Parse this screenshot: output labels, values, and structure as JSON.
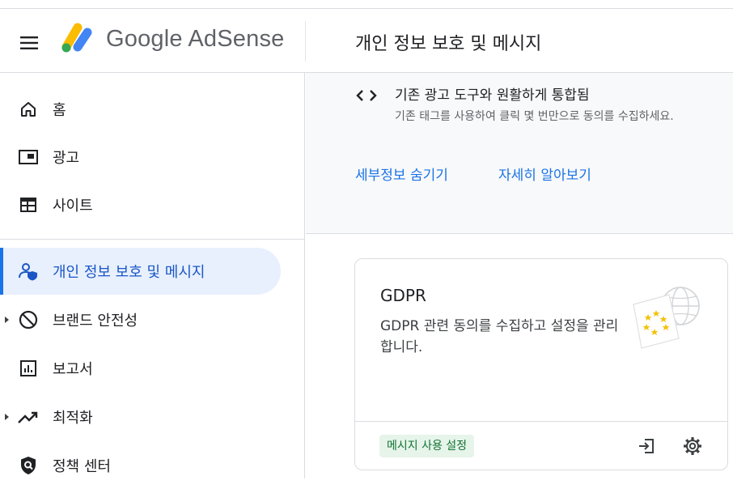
{
  "header": {
    "menu_icon": "menu-icon",
    "logo_text": "Google AdSense",
    "logo_colors": [
      "#fbbc04",
      "#4285f4",
      "#34a853"
    ],
    "page_title": "개인 정보 보호 및 메시지"
  },
  "sidebar": {
    "items": [
      {
        "label": "홈",
        "icon": "home-icon",
        "active": false,
        "expandable": false
      },
      {
        "label": "광고",
        "icon": "ads-icon",
        "active": false,
        "expandable": false
      },
      {
        "label": "사이트",
        "icon": "sites-icon",
        "active": false,
        "expandable": false
      },
      {
        "label": "개인 정보 보호 및 메시지",
        "icon": "privacy-person-icon",
        "active": true,
        "expandable": false
      },
      {
        "label": "브랜드 안전성",
        "icon": "block-icon",
        "active": false,
        "expandable": true
      },
      {
        "label": "보고서",
        "icon": "reports-icon",
        "active": false,
        "expandable": false
      },
      {
        "label": "최적화",
        "icon": "trending-up-icon",
        "active": false,
        "expandable": true
      },
      {
        "label": "정책 센터",
        "icon": "policy-shield-icon",
        "active": false,
        "expandable": false
      }
    ]
  },
  "info_panel": {
    "icon": "code-icon",
    "title": "기존 광고 도구와 원활하게 통합됨",
    "description": "기존 태그를 사용하여 클릭 몇 번만으로 동의를 수집하세요.",
    "hide_details_link": "세부정보 숨기기",
    "learn_more_link": "자세히 알아보기"
  },
  "gdpr_card": {
    "title": "GDPR",
    "description": "GDPR 관련 동의를 수집하고 설정을 관리합니다.",
    "illustration": "eu-flag-globe-illustration",
    "status_chip": "메시지 사용 설정",
    "actions": [
      "open-in-icon",
      "settings-gear-icon"
    ]
  },
  "colors": {
    "accent": "#1a73e8",
    "active_bg": "#e8f0fe",
    "chip_bg": "#e6f4ea",
    "chip_text": "#137333"
  }
}
